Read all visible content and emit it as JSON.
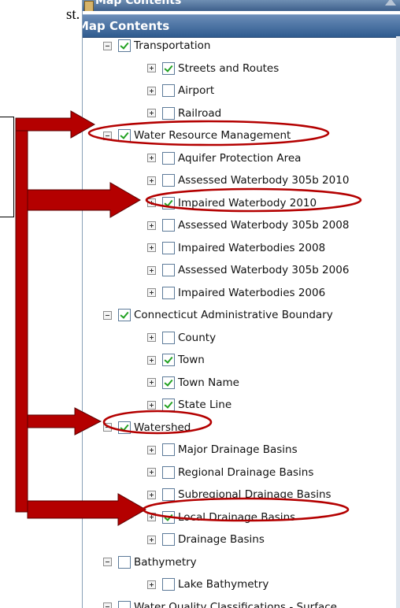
{
  "page": {
    "fragment_text": "st."
  },
  "panel": {
    "title": "Map Contents",
    "header": "Map Contents"
  },
  "tree": [
    {
      "label": "Transportation",
      "checked": true,
      "level": 0,
      "expanded": true
    },
    {
      "label": "Streets and Routes",
      "checked": true,
      "level": 1,
      "expanded": false
    },
    {
      "label": "Airport",
      "checked": false,
      "level": 1,
      "expanded": false
    },
    {
      "label": "Railroad",
      "checked": false,
      "level": 1,
      "expanded": false
    },
    {
      "label": "Water Resource Management",
      "checked": true,
      "level": 0,
      "expanded": true
    },
    {
      "label": "Aquifer Protection Area",
      "checked": false,
      "level": 1,
      "expanded": false
    },
    {
      "label": "Assessed Waterbody 305b 2010",
      "checked": false,
      "level": 1,
      "expanded": false
    },
    {
      "label": "Impaired Waterbody 2010",
      "checked": true,
      "level": 1,
      "expanded": false
    },
    {
      "label": "Assessed Waterbody 305b 2008",
      "checked": false,
      "level": 1,
      "expanded": false
    },
    {
      "label": "Impaired Waterbodies 2008",
      "checked": false,
      "level": 1,
      "expanded": false
    },
    {
      "label": "Assessed Waterbody 305b 2006",
      "checked": false,
      "level": 1,
      "expanded": false
    },
    {
      "label": "Impaired Waterbodies 2006",
      "checked": false,
      "level": 1,
      "expanded": false
    },
    {
      "label": "Connecticut Administrative Boundary",
      "checked": true,
      "level": 0,
      "expanded": true
    },
    {
      "label": "County",
      "checked": false,
      "level": 1,
      "expanded": false
    },
    {
      "label": "Town",
      "checked": true,
      "level": 1,
      "expanded": false
    },
    {
      "label": "Town Name",
      "checked": true,
      "level": 1,
      "expanded": false
    },
    {
      "label": "State Line",
      "checked": true,
      "level": 1,
      "expanded": false
    },
    {
      "label": "Watershed",
      "checked": true,
      "level": 0,
      "expanded": true
    },
    {
      "label": "Major Drainage Basins",
      "checked": false,
      "level": 1,
      "expanded": false
    },
    {
      "label": "Regional Drainage Basins",
      "checked": false,
      "level": 1,
      "expanded": false
    },
    {
      "label": "Subregional Drainage Basins",
      "checked": false,
      "level": 1,
      "expanded": false
    },
    {
      "label": "Local Drainage Basins",
      "checked": true,
      "level": 1,
      "expanded": false
    },
    {
      "label": "Drainage Basins",
      "checked": false,
      "level": 1,
      "expanded": false
    },
    {
      "label": "Bathymetry",
      "checked": false,
      "level": 0,
      "expanded": true
    },
    {
      "label": "Lake Bathymetry",
      "checked": false,
      "level": 1,
      "expanded": false
    },
    {
      "label": "Water Quality Classifications - Surface",
      "checked": false,
      "level": 0,
      "expanded": true
    }
  ],
  "colors": {
    "annotation": "#b40000",
    "checkmark": "#21a121",
    "header": "#3d6394"
  }
}
